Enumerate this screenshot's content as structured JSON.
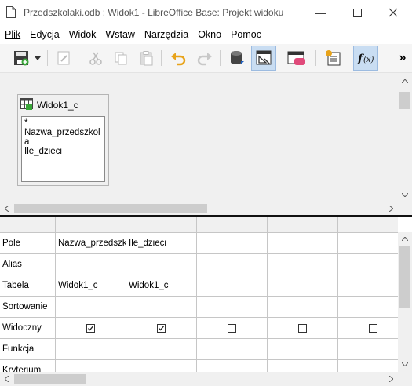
{
  "window": {
    "title": "Przedszkolaki.odb : Widok1 - LibreOffice Base: Projekt widoku"
  },
  "menu": [
    "Plik",
    "Edycja",
    "Widok",
    "Wstaw",
    "Narzędzia",
    "Okno",
    "Pomoc"
  ],
  "toolbar": {
    "overflow_label": "»",
    "icons": [
      "save-icon",
      "dropdown-arrow-icon",
      "edit-icon",
      "cut-icon",
      "copy-icon",
      "paste-icon",
      "undo-icon",
      "redo-icon",
      "add-table-icon",
      "design-view-icon",
      "run-query-icon",
      "add-field-icon",
      "functions-icon"
    ]
  },
  "table_window": {
    "title": "Widok1_c",
    "fields": [
      "*",
      "Nazwa_przedszkola",
      "Ile_dzieci"
    ]
  },
  "grid": {
    "row_labels": [
      "Pole",
      "Alias",
      "Tabela",
      "Sortowanie",
      "Widoczny",
      "Funkcja",
      "Kryterium"
    ],
    "columns": [
      {
        "pole": "Nazwa_przedszk",
        "tabela": "Widok1_c",
        "widoczny": true
      },
      {
        "pole": "Ile_dzieci",
        "tabela": "Widok1_c",
        "widoczny": true
      },
      {
        "pole": "",
        "tabela": "",
        "widoczny": false
      },
      {
        "pole": "",
        "tabela": "",
        "widoczny": false
      },
      {
        "pole": "",
        "tabela": "",
        "widoczny": false
      }
    ]
  },
  "colors": {
    "active_button": "#c9ddf2",
    "pane_bg": "#f0f0f0",
    "splitter": "#111111",
    "undo_yellow": "#e8a31a"
  }
}
